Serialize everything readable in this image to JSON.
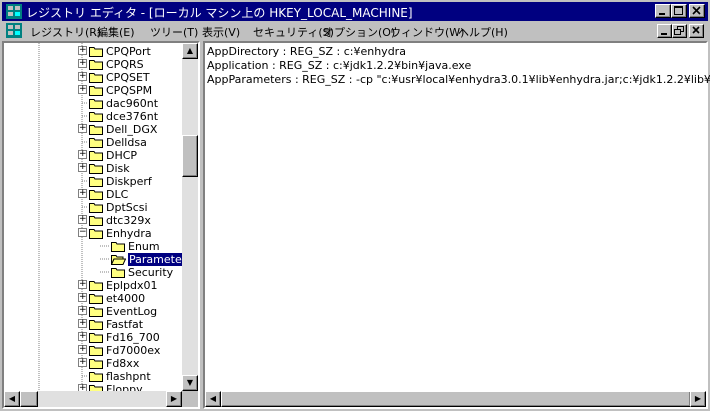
{
  "window": {
    "title": "レジストリ エディタ - [ローカル マシン上の HKEY_LOCAL_MACHINE]"
  },
  "menu": [
    {
      "label": "レジストリ(R)"
    },
    {
      "label": "編集(E)"
    },
    {
      "label": "ツリー(T)"
    },
    {
      "label": "表示(V)"
    },
    {
      "label": "セキュリティ(S)"
    },
    {
      "label": "オプション(O)"
    },
    {
      "label": "ウィンドウ(W)"
    },
    {
      "label": "ヘルプ(H)"
    }
  ],
  "tree": {
    "items": [
      {
        "label": "CPQPort",
        "expander": "+"
      },
      {
        "label": "CPQRS",
        "expander": "+"
      },
      {
        "label": "CPQSET",
        "expander": "+"
      },
      {
        "label": "CPQSPM",
        "expander": "+"
      },
      {
        "label": "dac960nt",
        "expander": ""
      },
      {
        "label": "dce376nt",
        "expander": ""
      },
      {
        "label": "Dell_DGX",
        "expander": "+"
      },
      {
        "label": "Delldsa",
        "expander": ""
      },
      {
        "label": "DHCP",
        "expander": "+"
      },
      {
        "label": "Disk",
        "expander": "+"
      },
      {
        "label": "Diskperf",
        "expander": ""
      },
      {
        "label": "DLC",
        "expander": "+"
      },
      {
        "label": "DptScsi",
        "expander": ""
      },
      {
        "label": "dtc329x",
        "expander": "+"
      },
      {
        "label": "Enhydra",
        "expander": "-"
      },
      {
        "label": "Enum",
        "expander": "",
        "child": true
      },
      {
        "label": "Parameters",
        "expander": "",
        "child": true,
        "selected": true,
        "open": true
      },
      {
        "label": "Security",
        "expander": "",
        "child": true
      },
      {
        "label": "Eplpdx01",
        "expander": "+"
      },
      {
        "label": "et4000",
        "expander": "+"
      },
      {
        "label": "EventLog",
        "expander": "+"
      },
      {
        "label": "Fastfat",
        "expander": "+"
      },
      {
        "label": "Fd16_700",
        "expander": "+"
      },
      {
        "label": "Fd7000ex",
        "expander": "+"
      },
      {
        "label": "Fd8xx",
        "expander": "+"
      },
      {
        "label": "flashpnt",
        "expander": ""
      },
      {
        "label": "Floppy",
        "expander": "+"
      }
    ]
  },
  "values": [
    {
      "text": "AppDirectory : REG_SZ : c:¥enhydra"
    },
    {
      "text": "Application : REG_SZ : c:¥jdk1.2.2¥bin¥java.exe"
    },
    {
      "text": "AppParameters : REG_SZ : -cp \"c:¥usr¥local¥enhydra3.0.1¥lib¥enhydra.jar;c:¥jdk1.2.2¥lib¥"
    }
  ],
  "colors": {
    "titlebar": "#000080",
    "selection": "#000080",
    "folder": "#ffff80"
  }
}
